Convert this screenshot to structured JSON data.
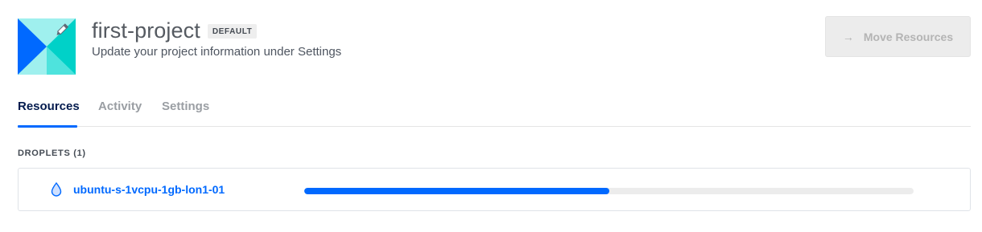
{
  "header": {
    "title": "first-project",
    "badge": "DEFAULT",
    "subtitle": "Update your project information under Settings",
    "logo_icon": "project-logo-pencil-icon",
    "move_button": {
      "label": "Move Resources",
      "icon": "arrow-right-icon",
      "disabled": true
    }
  },
  "tabs": [
    {
      "label": "Resources",
      "active": true
    },
    {
      "label": "Activity",
      "active": false
    },
    {
      "label": "Settings",
      "active": false
    }
  ],
  "droplets": {
    "heading": "DROPLETS (1)",
    "items": [
      {
        "name": "ubuntu-s-1vcpu-1gb-lon1-01",
        "icon": "droplet-icon",
        "progress": 0.5
      }
    ]
  },
  "colors": {
    "accent": "#0069ff",
    "logo_blue": "#0069ff",
    "logo_teal": "#00d1c8",
    "logo_light": "#9ff0ee",
    "tab_active": "#031b4e"
  }
}
